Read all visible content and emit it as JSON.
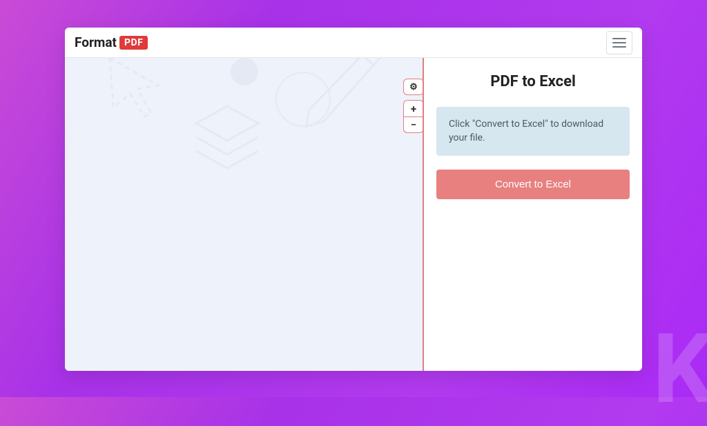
{
  "header": {
    "logo_text": "Format",
    "logo_badge": "PDF"
  },
  "panel": {
    "title": "PDF to Excel",
    "info_message": "Click \"Convert to Excel\" to download your file.",
    "convert_label": "Convert to Excel"
  },
  "toolbar": {
    "settings_icon": "⚙",
    "zoom_in": "+",
    "zoom_out": "−"
  }
}
